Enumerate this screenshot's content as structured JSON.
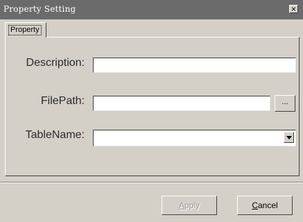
{
  "window": {
    "title": "Property Setting",
    "close_glyph": "×"
  },
  "tabs": [
    {
      "label": "Property",
      "active": true
    }
  ],
  "form": {
    "description": {
      "label": "Description:",
      "value": ""
    },
    "filepath": {
      "label": "FilePath:",
      "value": "",
      "browse_label": "..."
    },
    "tablename": {
      "label": "TableName:",
      "value": ""
    }
  },
  "buttons": {
    "apply_mnemonic": "A",
    "apply_rest": "pply",
    "apply_enabled": false,
    "cancel_mnemonic": "C",
    "cancel_rest": "ancel"
  },
  "icons": {
    "close": "close-icon",
    "dropdown": "chevron-down-icon"
  }
}
